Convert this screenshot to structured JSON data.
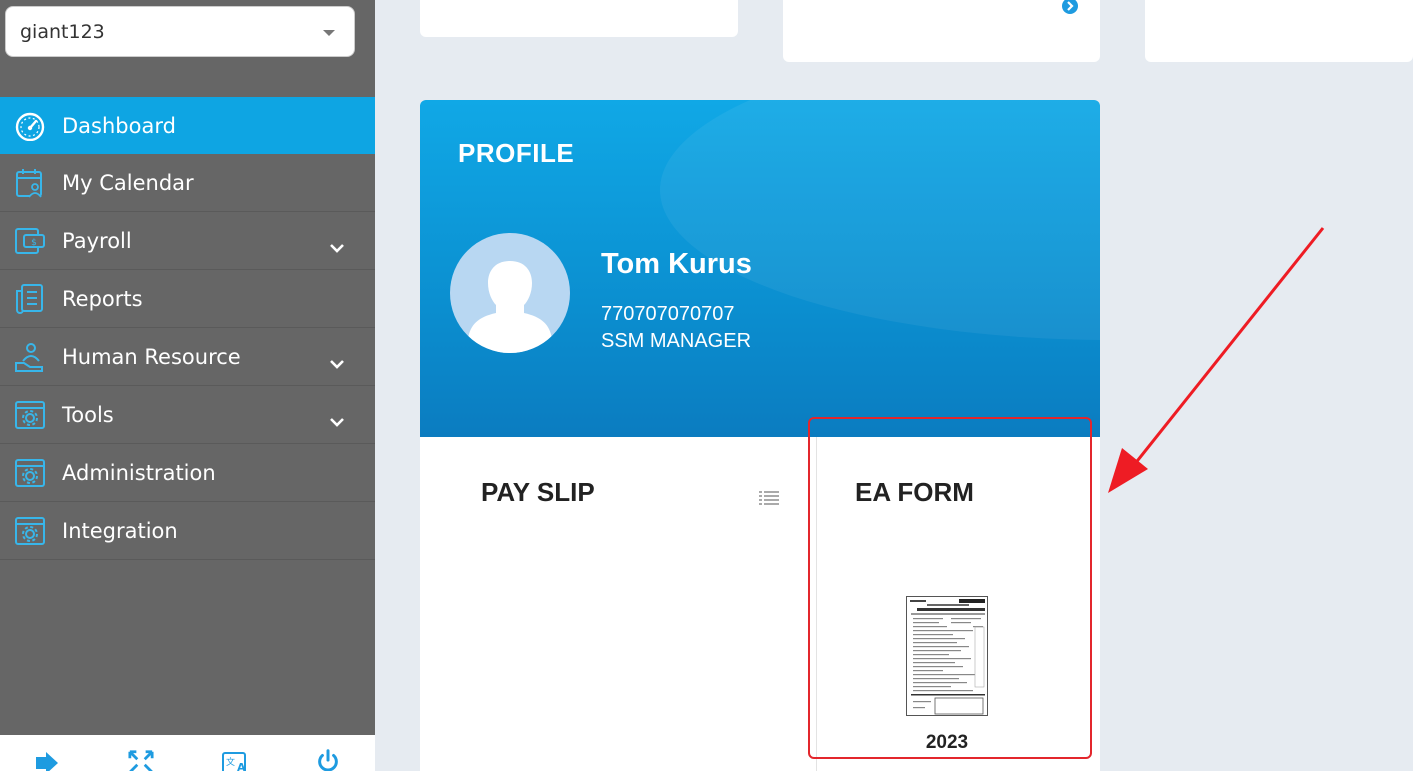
{
  "sidebar": {
    "company": "giant123",
    "items": [
      {
        "label": "Dashboard",
        "icon": "dashboard-gauge-icon",
        "active": true,
        "expandable": false
      },
      {
        "label": "My Calendar",
        "icon": "calendar-user-icon",
        "active": false,
        "expandable": false
      },
      {
        "label": "Payroll",
        "icon": "payroll-money-icon",
        "active": false,
        "expandable": true
      },
      {
        "label": "Reports",
        "icon": "reports-document-icon",
        "active": false,
        "expandable": false
      },
      {
        "label": "Human Resource",
        "icon": "human-resource-icon",
        "active": false,
        "expandable": true
      },
      {
        "label": "Tools",
        "icon": "tools-window-icon",
        "active": false,
        "expandable": true
      },
      {
        "label": "Administration",
        "icon": "administration-window-icon",
        "active": false,
        "expandable": false
      },
      {
        "label": "Integration",
        "icon": "integration-window-icon",
        "active": false,
        "expandable": false
      }
    ],
    "footer_icons": [
      "logout-icon",
      "fullscreen-icon",
      "translate-icon",
      "power-icon"
    ]
  },
  "profile": {
    "title": "PROFILE",
    "name": "Tom Kurus",
    "id_number": "770707070707",
    "role": "SSM MANAGER"
  },
  "payslip": {
    "title": "PAY SLIP"
  },
  "ea_form": {
    "title": "EA FORM",
    "year": "2023"
  },
  "colors": {
    "accent": "#0ea5e3",
    "sidebar_bg": "#666666",
    "highlight": "#e3262c"
  }
}
